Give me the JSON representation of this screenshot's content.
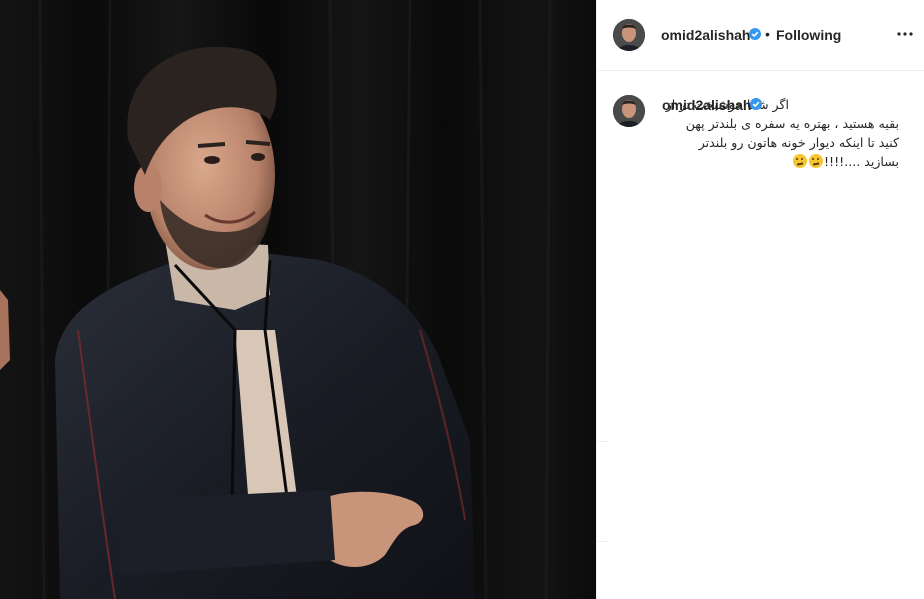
{
  "post": {
    "username": "omid2alishah",
    "verified": true,
    "follow_status": "Following",
    "separator": "•",
    "caption_lines": [
      "اگر شما خوشبخت تر از",
      "بقیه هستید ، بهتره یه سفره ی بلندتر پهن",
      "کنید تا اینکه دیوار خونه هاتون رو بلندتر",
      "بسازید ....!!!!"
    ]
  },
  "icons": {
    "verified_badge": "verified-badge-icon",
    "more": "more-options-icon",
    "emoji": "thinking-face-emoji"
  },
  "colors": {
    "text": "#262626",
    "verified_blue": "#3897f0",
    "border": "#efefef",
    "photo_background": "#0b0b0b"
  }
}
